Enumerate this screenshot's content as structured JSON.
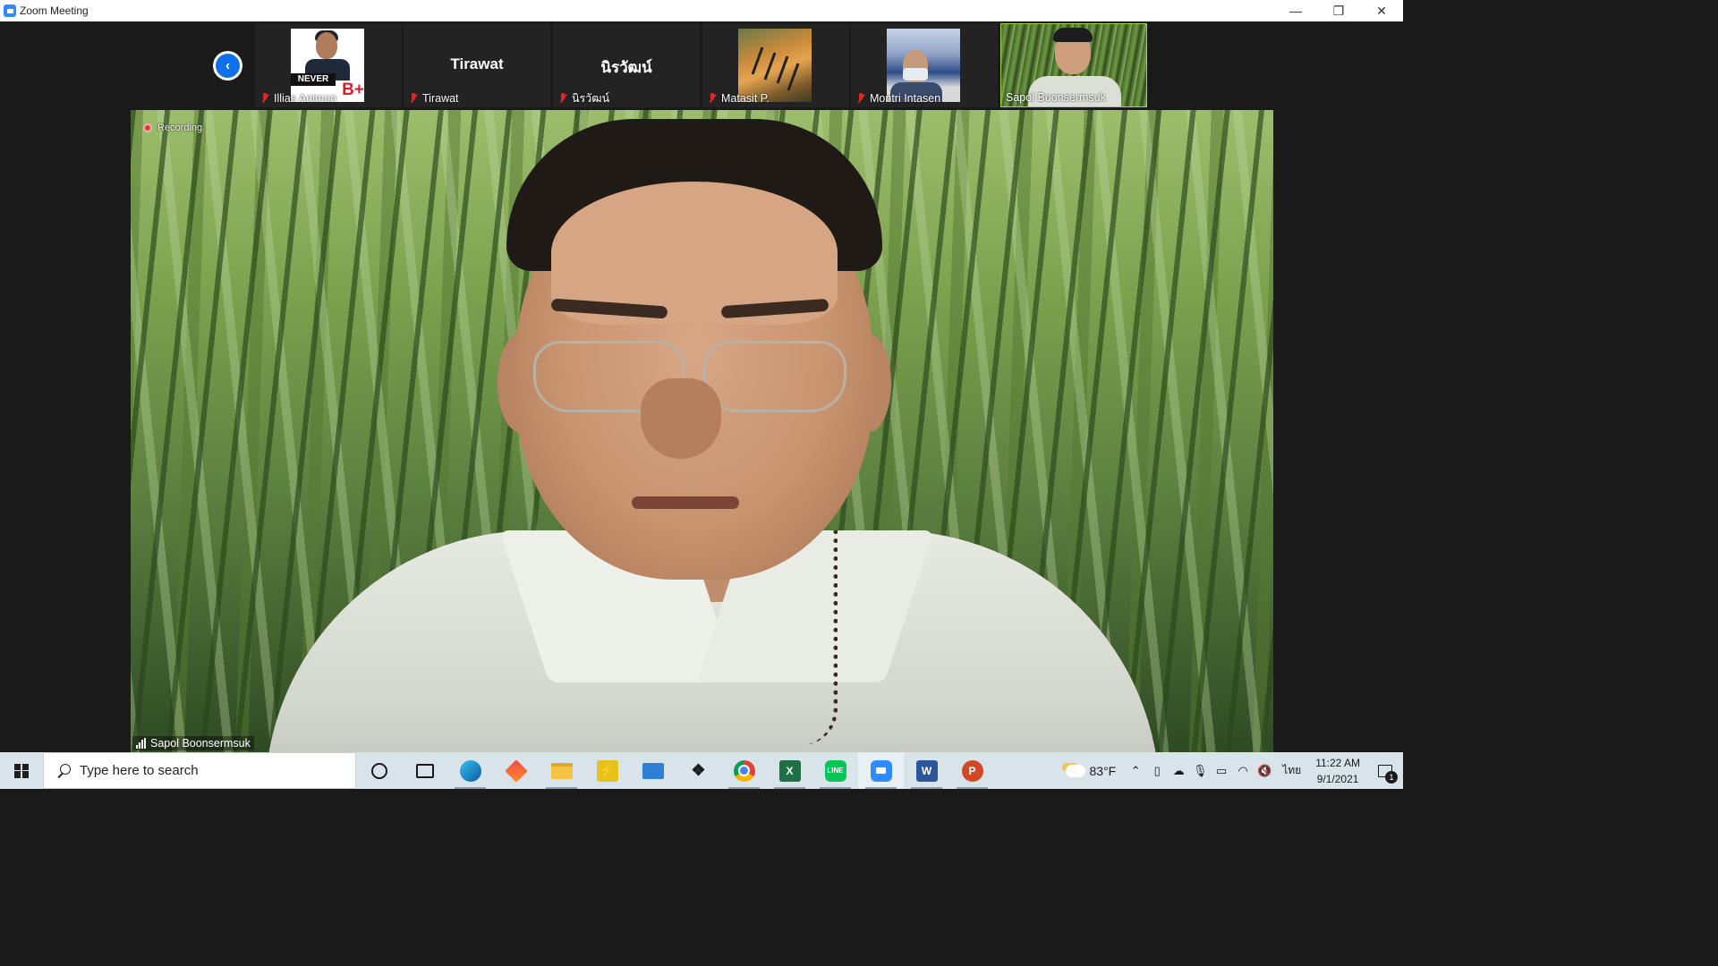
{
  "window": {
    "title": "Zoom Meeting",
    "controls": {
      "minimize": "—",
      "restore": "❐",
      "close": "✕"
    }
  },
  "gallery": {
    "participants": [
      {
        "name": "Illias Animon",
        "muted": true,
        "avatar_text": "NEVER",
        "avatar_badge": "B+"
      },
      {
        "name": "Tirawat",
        "muted": true,
        "display_text": "Tirawat"
      },
      {
        "name": "นิรวัฒน์",
        "muted": true,
        "display_text": "นิรวัฒน์"
      },
      {
        "name": "Matasit P.",
        "muted": true
      },
      {
        "name": "Montri Intasen",
        "muted": true
      },
      {
        "name": "Sapol Boonsermsuk",
        "muted": false,
        "active_speaker": true
      }
    ]
  },
  "main_video": {
    "recording_label": "Recording",
    "speaker_name": "Sapol Boonsermsuk"
  },
  "taskbar": {
    "search_placeholder": "Type here to search",
    "apps": [
      "cortana",
      "task-view",
      "edge",
      "app-diamond",
      "file-explorer",
      "app-bolt",
      "mail",
      "dropbox",
      "chrome",
      "excel",
      "line",
      "zoom",
      "word",
      "powerpoint"
    ],
    "weather_temp": "83°F",
    "language": "ไทย",
    "time": "11:22 AM",
    "date": "9/1/2021",
    "notification_count": "1"
  },
  "colors": {
    "zoom_blue": "#2d8cff",
    "active_speaker_border": "#a6d33a",
    "muted_red": "#e02828",
    "recording_red": "#e23a3a"
  }
}
